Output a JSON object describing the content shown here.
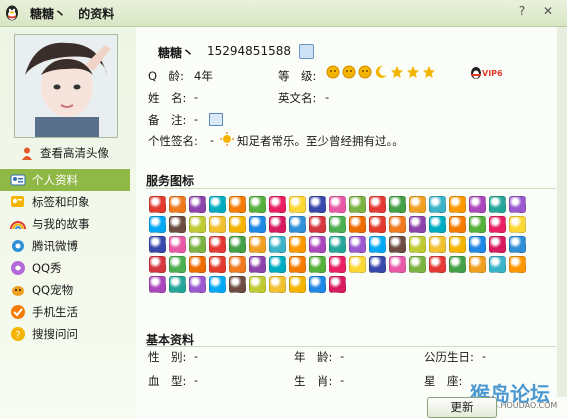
{
  "window": {
    "nickname": "糖糖丶",
    "title_suffix": "的资料",
    "help_icon": "help-icon",
    "close_icon": "close-icon"
  },
  "left": {
    "hd_label": "查看高清头像",
    "nav": [
      {
        "label": "个人资料",
        "icon": "card-icon",
        "active": true
      },
      {
        "label": "标签和印象",
        "icon": "tag-icon"
      },
      {
        "label": "与我的故事",
        "icon": "rainbow-icon"
      },
      {
        "label": "腾讯微博",
        "icon": "weibo-icon"
      },
      {
        "label": "QQ秀",
        "icon": "qqshow-icon"
      },
      {
        "label": "QQ宠物",
        "icon": "pet-icon"
      },
      {
        "label": "手机生活",
        "icon": "phone-check-icon"
      },
      {
        "label": "搜搜问问",
        "icon": "question-icon"
      }
    ]
  },
  "profile": {
    "nickname": "糖糖丶",
    "qq_number": "15294851588",
    "age_label": "Q　龄:",
    "age_value": "4年",
    "level_label": "等　级:",
    "name_label": "姓　名:",
    "name_value": "-",
    "en_name_label": "英文名:",
    "en_name_value": "-",
    "remark_label": "备　注:",
    "remark_value": "-",
    "signature_label": "个性签名:",
    "signature_prefix": "-",
    "signature_value": "知足者常乐。至少曾经拥有过。。",
    "vip_label": "VIP6"
  },
  "services": {
    "title": "服务图标",
    "icon_colors": [
      "#e23b2e",
      "#f0a020",
      "#2f8fd8",
      "#e85aa8",
      "#f2c12e",
      "#56b03c",
      "#9b59d0",
      "#f07a1e",
      "#3bb3c9",
      "#d6363e",
      "#7cb342",
      "#f4b400",
      "#e91e63",
      "#03a9f4",
      "#8e44ad",
      "#ff9800",
      "#4caf50",
      "#e53935",
      "#1e88e5",
      "#fdd835",
      "#6d4c41",
      "#00acc1",
      "#ab47bc",
      "#ef6c00",
      "#43a047",
      "#d81b60",
      "#3949ab",
      "#c0ca33",
      "#f57c00",
      "#26a69a"
    ],
    "count": 86
  },
  "basic": {
    "title": "基本资料",
    "gender_label": "性　别:",
    "gender_value": "-",
    "age_label": "年　龄:",
    "age_value": "-",
    "birthday_label": "公历生日:",
    "birthday_value": "-",
    "blood_label": "血　型:",
    "blood_value": "-",
    "zodiac_label": "生　肖:",
    "zodiac_value": "-",
    "constellation_label": "星　座:"
  },
  "footer": {
    "refresh_label": "更新",
    "watermark": "猴岛论坛",
    "watermark_sub": "BBS.HOUDAO.COM"
  }
}
